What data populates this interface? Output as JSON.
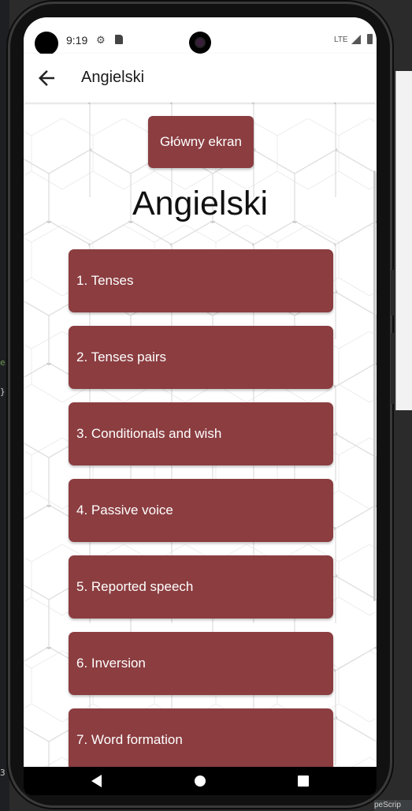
{
  "ide": {
    "code_snippet_1": "es",
    "code_snippet_2": "}-",
    "code_snippet_3": "3",
    "bottom_text": "peScrip"
  },
  "status_bar": {
    "time": "9:19",
    "network": "LTE",
    "icons": [
      "settings-gear-icon",
      "sim-card-icon",
      "signal-icon",
      "battery-icon"
    ]
  },
  "app_bar": {
    "title": "Angielski",
    "back_icon": "arrow-left-icon"
  },
  "main": {
    "home_button_label": "Główny ekran",
    "heading": "Angielski",
    "topics": [
      "1. Tenses",
      "2. Tenses pairs",
      "3. Conditionals and wish",
      "4. Passive voice",
      "5. Reported speech",
      "6. Inversion",
      "7. Word formation"
    ]
  },
  "nav_bar": {
    "icons": [
      "back-triangle-icon",
      "home-circle-icon",
      "recents-square-icon"
    ]
  },
  "colors": {
    "button": "#8b3d40",
    "button_text": "#ffffff",
    "background": "#ffffff",
    "pattern": "#d9d9d9"
  }
}
